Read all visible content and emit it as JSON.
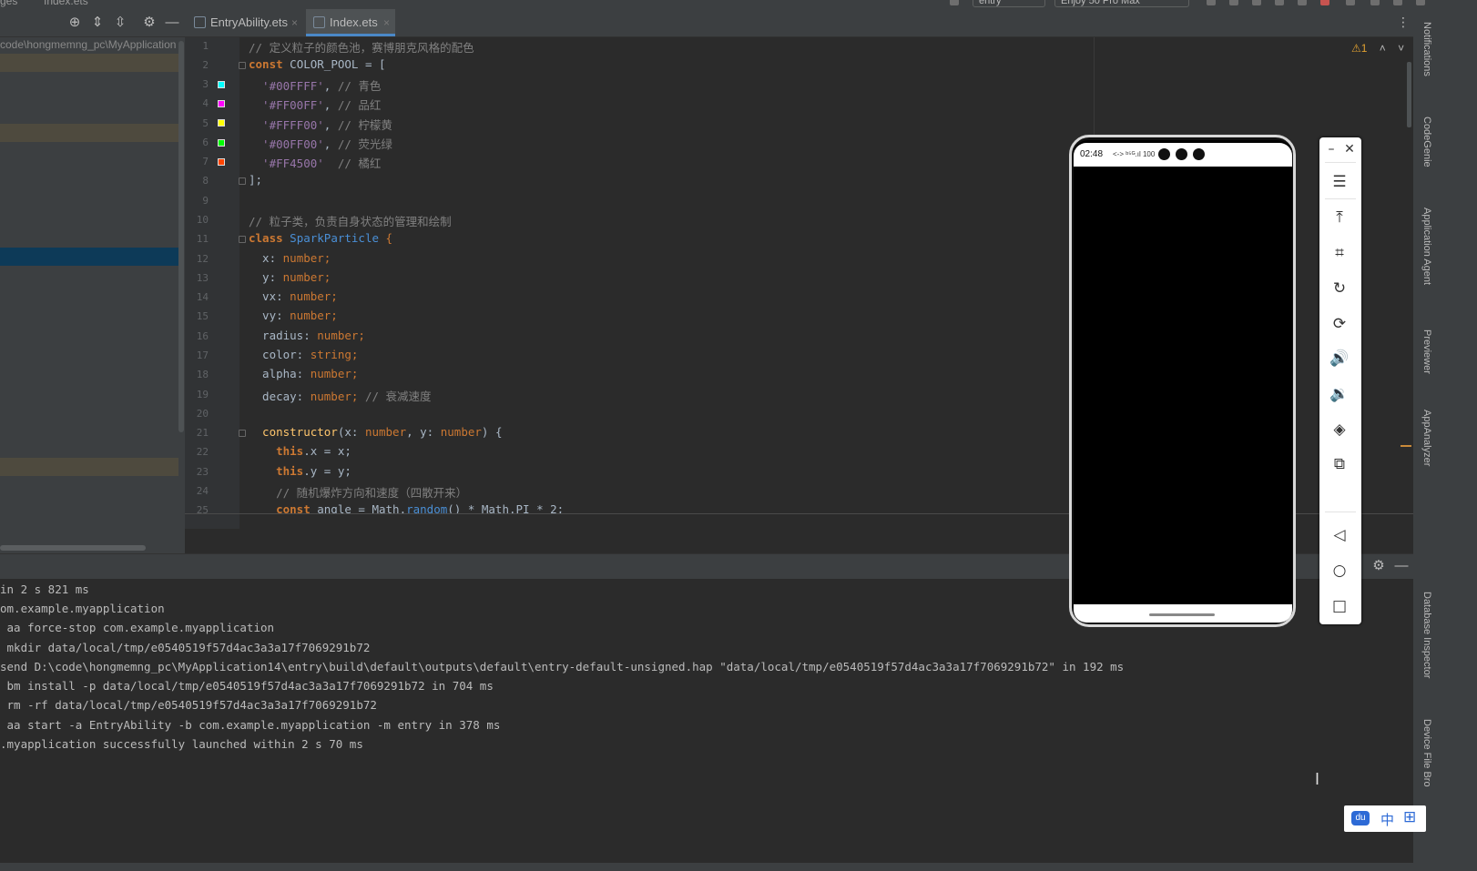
{
  "breadcrumb": {
    "part1": "ges",
    "part2": "Index.ets"
  },
  "toolbar": {
    "run_config": "entry",
    "device": "Enjoy 50 Pro Max"
  },
  "project": {
    "path": "code\\hongmemng_pc\\MyApplication"
  },
  "tabs": [
    {
      "label": "EntryAbility.ets",
      "close": "×"
    },
    {
      "label": "Index.ets",
      "close": "×"
    }
  ],
  "editor": {
    "warnings": "⚠1",
    "lines": [
      {
        "n": "1"
      },
      {
        "n": "2"
      },
      {
        "n": "3"
      },
      {
        "n": "4"
      },
      {
        "n": "5"
      },
      {
        "n": "6"
      },
      {
        "n": "7"
      },
      {
        "n": "8"
      },
      {
        "n": "9"
      },
      {
        "n": "10"
      },
      {
        "n": "11"
      },
      {
        "n": "12"
      },
      {
        "n": "13"
      },
      {
        "n": "14"
      },
      {
        "n": "15"
      },
      {
        "n": "16"
      },
      {
        "n": "17"
      },
      {
        "n": "18"
      },
      {
        "n": "19"
      },
      {
        "n": "20"
      },
      {
        "n": "21"
      },
      {
        "n": "22"
      },
      {
        "n": "23"
      },
      {
        "n": "24"
      },
      {
        "n": "25"
      }
    ],
    "code": {
      "l1": "// 定义粒子的颜色池，赛博朋克风格的配色",
      "l2a": "const",
      "l2b": " COLOR_POOL = [",
      "l3a": "  '#00FFFF'",
      "l3b": ", ",
      "l3c": "// 青色",
      "l4a": "  '#FF00FF'",
      "l4b": ", ",
      "l4c": "// 品红",
      "l5a": "  '#FFFF00'",
      "l5b": ", ",
      "l5c": "// 柠檬黄",
      "l6a": "  '#00FF00'",
      "l6b": ", ",
      "l6c": "// 荧光绿",
      "l7a": "  '#FF4500'",
      "l7b": "  ",
      "l7c": "// 橘红",
      "l8": "];",
      "l10": "// 粒子类，负责自身状态的管理和绘制",
      "l11a": "class",
      "l11b": " SparkParticle",
      "l11c": " {",
      "l12a": "  x: ",
      "l12b": "number;",
      "l13a": "  y: ",
      "l13b": "number;",
      "l14a": "  vx: ",
      "l14b": "number;",
      "l15a": "  vy: ",
      "l15b": "number;",
      "l16a": "  radius: ",
      "l16b": "number;",
      "l17a": "  color: ",
      "l17b": "string;",
      "l18a": "  alpha: ",
      "l18b": "number;",
      "l19a": "  decay: ",
      "l19b": "number;",
      "l19c": " // 衰减速度",
      "l21a": "  constructor",
      "l21b": "(x: ",
      "l21c": "number",
      "l21d": ", y: ",
      "l21e": "number",
      "l21f": ") {",
      "l22a": "    this",
      "l22b": ".x = x;",
      "l23a": "    this",
      "l23b": ".y = y;",
      "l24": "    // 随机爆炸方向和速度（四散开来）",
      "l25a": "    const",
      "l25b": " angle = Math.",
      "l25c": "random",
      "l25d": "() * Math.PI * 2;"
    },
    "swatches": [
      "#00FFFF",
      "#FF00FF",
      "#FFFF00",
      "#00FF00",
      "#FF4500"
    ]
  },
  "run": {
    "lines": [
      "in 2 s 821 ms",
      "om.example.myapplication",
      " aa force-stop com.example.myapplication",
      " mkdir data/local/tmp/e0540519f57d4ac3a3a17f7069291b72",
      "send D:\\code\\hongmemng_pc\\MyApplication14\\entry\\build\\default\\outputs\\default\\entry-default-unsigned.hap \"data/local/tmp/e0540519f57d4ac3a3a17f7069291b72\" in 192 ms",
      " bm install -p data/local/tmp/e0540519f57d4ac3a3a17f7069291b72 in 704 ms",
      " rm -rf data/local/tmp/e0540519f57d4ac3a3a17f7069291b72",
      " aa start -a EntryAbility -b com.example.myapplication -m entry in 378 ms",
      ".myapplication successfully launched within 2 s 70 ms"
    ]
  },
  "right_tools": [
    "Notifications",
    "CodeGenie",
    "Application Agent",
    "Previewer",
    "AppAnalyzer",
    "Database Inspector",
    "Device File Bro"
  ],
  "phone": {
    "time": "02:48",
    "status_icons": "<-> ᵇ⁵ᴳ.ıl 100"
  },
  "ime": {
    "lang": "中",
    "logo": "du",
    "grid": "⊞"
  }
}
